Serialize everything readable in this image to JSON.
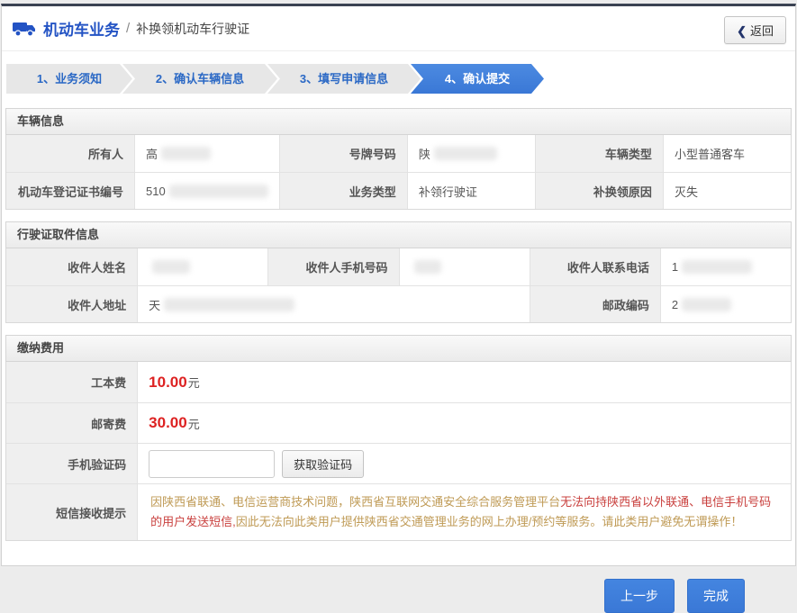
{
  "header": {
    "title": "机动车业务",
    "separator": "/",
    "subtitle": "补换领机动车行驶证",
    "back_chevron": "❮",
    "back_label": "返回"
  },
  "steps": {
    "items": [
      {
        "label": "1、业务须知"
      },
      {
        "label": "2、确认车辆信息"
      },
      {
        "label": "3、填写申请信息"
      },
      {
        "label": "4、确认提交"
      }
    ],
    "active_index": 3
  },
  "vehicle": {
    "section_title": "车辆信息",
    "fields": [
      {
        "label": "所有人",
        "value": "高"
      },
      {
        "label": "号牌号码",
        "value": "陕"
      },
      {
        "label": "车辆类型",
        "value": "小型普通客车"
      },
      {
        "label": "机动车登记证书编号",
        "value": "510"
      },
      {
        "label": "业务类型",
        "value": "补领行驶证"
      },
      {
        "label": "补换领原因",
        "value": "灭失"
      }
    ]
  },
  "pickup": {
    "section_title": "行驶证取件信息",
    "fields": [
      {
        "label": "收件人姓名",
        "value": ""
      },
      {
        "label": "收件人手机号码",
        "value": ""
      },
      {
        "label": "收件人联系电话",
        "value": "1"
      },
      {
        "label": "收件人地址",
        "value": "天"
      },
      {
        "label": "邮政编码",
        "value": "2"
      }
    ]
  },
  "fees": {
    "section_title": "缴纳费用",
    "cost_label": "工本费",
    "cost_value": "10.00",
    "cost_unit": "元",
    "postage_label": "邮寄费",
    "postage_value": "30.00",
    "postage_unit": "元",
    "captcha_label": "手机验证码",
    "captcha_button": "获取验证码",
    "sms_label": "短信接收提示",
    "sms_part1": "因陕西省联通、电信运营商技术问题，陕西省互联网交通安全综合服务管理平台",
    "sms_part2": "无法向持陕西省以外联通、电信手机号码的用户发送短信,",
    "sms_part3": "因此无法向此类用户提供陕西省交通管理业务的网上办理/预约等服务。请此类用户避免无谓操作！"
  },
  "footer": {
    "prev_label": "上一步",
    "finish_label": "完成"
  },
  "colors": {
    "brand_blue": "#2353c4",
    "step_active_blue": "#3a78d6",
    "fee_red": "#dd2222",
    "warning_tan": "#bf9a55",
    "warning_red": "#c9403e"
  }
}
